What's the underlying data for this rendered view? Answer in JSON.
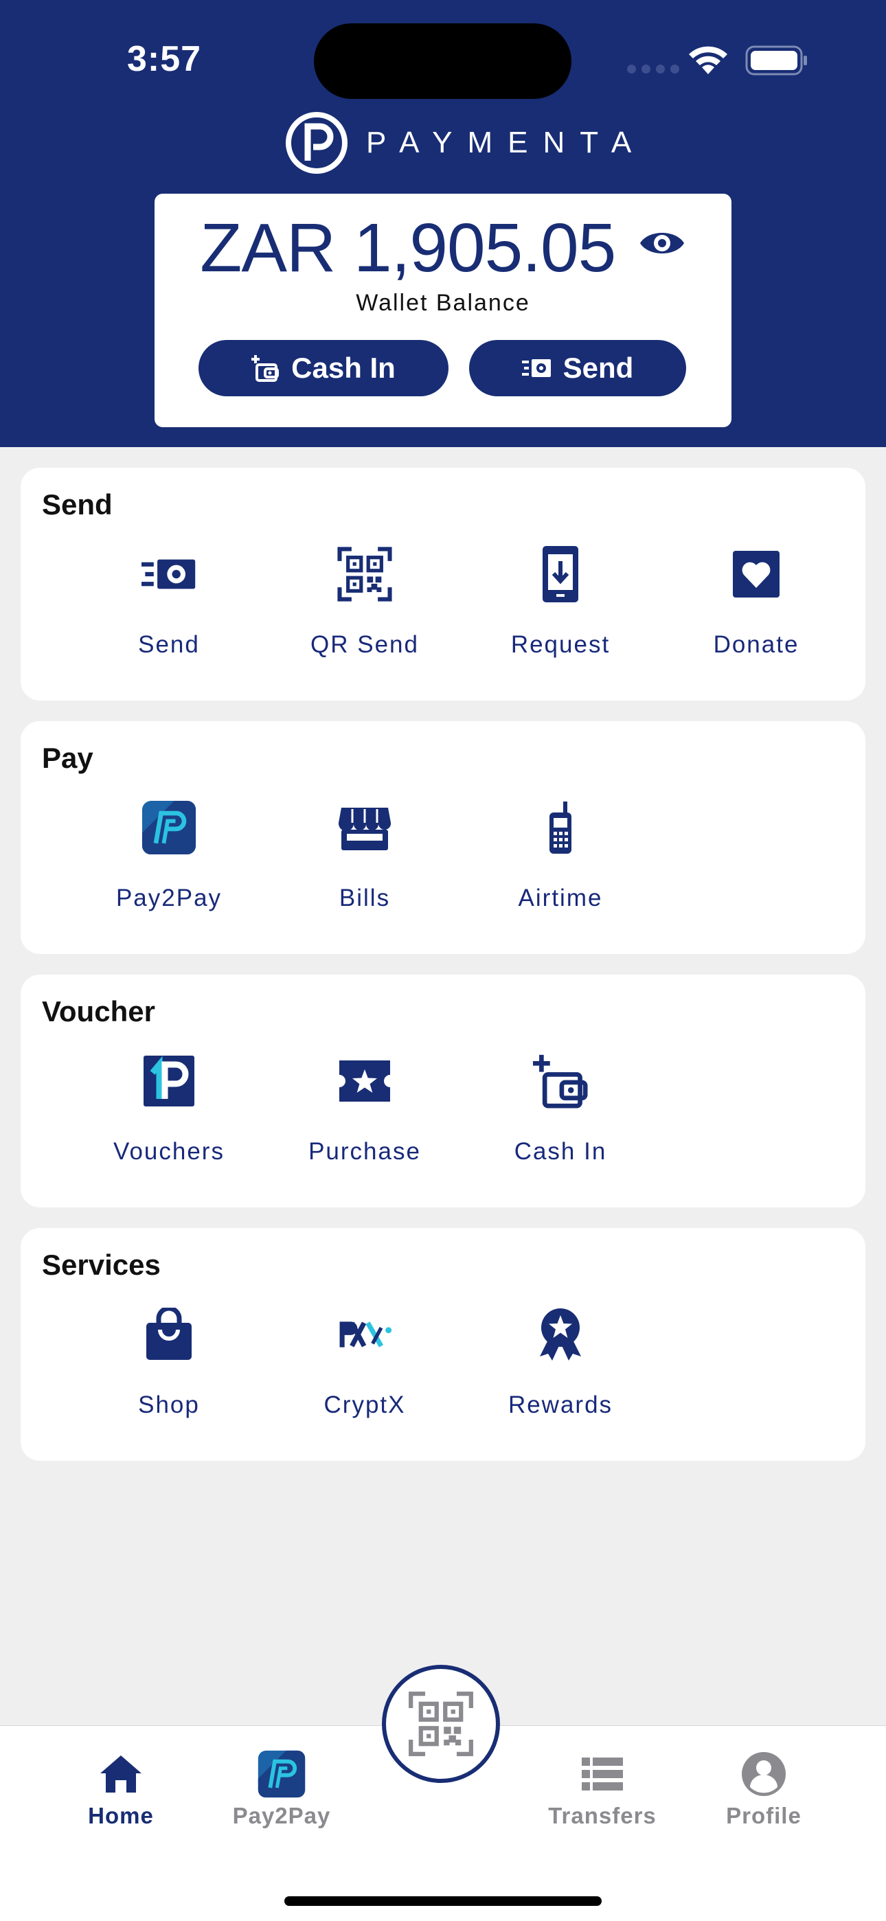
{
  "status_bar": {
    "time": "3:57"
  },
  "brand": {
    "name": "PAYMENTA",
    "colors": {
      "primary": "#182d74",
      "accent": "#2cc3e0"
    }
  },
  "balance": {
    "amount": "ZAR 1,905.05",
    "label": "Wallet Balance",
    "cash_in_label": "Cash In",
    "send_label": "Send"
  },
  "sections": [
    {
      "title": "Send",
      "items": [
        {
          "label": "Send",
          "icon": "send-money-icon"
        },
        {
          "label": "QR Send",
          "icon": "qr-code-icon"
        },
        {
          "label": "Request",
          "icon": "phone-download-icon"
        },
        {
          "label": "Donate",
          "icon": "heart-icon"
        }
      ]
    },
    {
      "title": "Pay",
      "items": [
        {
          "label": "Pay2Pay",
          "icon": "pay2pay-logo-icon"
        },
        {
          "label": "Bills",
          "icon": "storefront-icon"
        },
        {
          "label": "Airtime",
          "icon": "mobile-phone-icon"
        }
      ]
    },
    {
      "title": "Voucher",
      "items": [
        {
          "label": "Vouchers",
          "icon": "voucher-1p-icon"
        },
        {
          "label": "Purchase",
          "icon": "ticket-star-icon"
        },
        {
          "label": "Cash In",
          "icon": "wallet-plus-icon"
        }
      ]
    },
    {
      "title": "Services",
      "items": [
        {
          "label": "Shop",
          "icon": "shopping-bag-icon"
        },
        {
          "label": "CryptX",
          "icon": "cryptx-logo-icon"
        },
        {
          "label": "Rewards",
          "icon": "award-ribbon-icon"
        }
      ]
    }
  ],
  "tabbar": {
    "items": [
      {
        "label": "Home",
        "icon": "home-icon",
        "active": true
      },
      {
        "label": "Pay2Pay",
        "icon": "pay2pay-logo-icon",
        "active": false
      },
      {
        "label": "Transfers",
        "icon": "list-icon",
        "active": false
      },
      {
        "label": "Profile",
        "icon": "person-icon",
        "active": false
      }
    ],
    "center_button_icon": "qr-scan-icon"
  }
}
